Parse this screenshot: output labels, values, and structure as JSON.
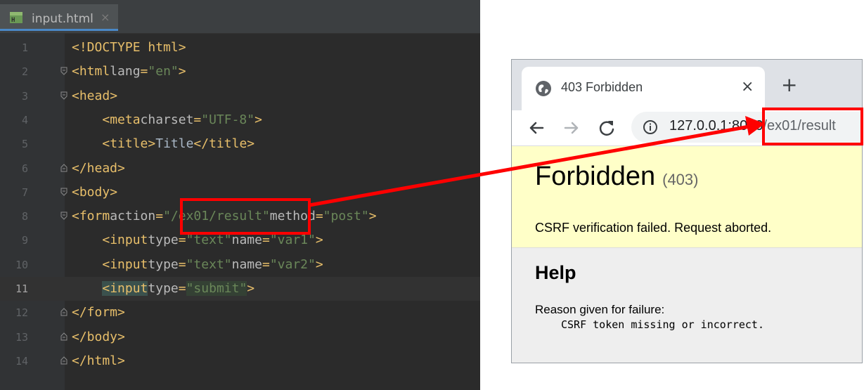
{
  "editor": {
    "tab": {
      "filename": "input.html",
      "close_glyph": "×",
      "icon": "html-file-icon"
    },
    "current_line": 11,
    "lines": [
      {
        "num": "1",
        "code": "<!DOCTYPE html>"
      },
      {
        "num": "2",
        "code": "<html lang=\"en\">"
      },
      {
        "num": "3",
        "code": "<head>"
      },
      {
        "num": "4",
        "code": "    <meta charset=\"UTF-8\">"
      },
      {
        "num": "5",
        "code": "    <title>Title</title>"
      },
      {
        "num": "6",
        "code": "</head>"
      },
      {
        "num": "7",
        "code": "<body>"
      },
      {
        "num": "8",
        "code": "<form action=\"/ex01/result\" method=\"post\">"
      },
      {
        "num": "9",
        "code": "    <input type=\"text\" name=\"var1\">"
      },
      {
        "num": "10",
        "code": "    <input type=\"text\" name=\"var2\">"
      },
      {
        "num": "11",
        "code": "    <input type=\"submit\">"
      },
      {
        "num": "12",
        "code": "</form>"
      },
      {
        "num": "13",
        "code": "</body>"
      },
      {
        "num": "14",
        "code": "</html>"
      }
    ]
  },
  "browser": {
    "tab_title": "403 Forbidden",
    "tab_close": "×",
    "new_tab": "+",
    "url_host": "127.0.0.1:8000",
    "url_path": "/ex01/result",
    "heading": "Forbidden",
    "status_code": "(403)",
    "message": "CSRF verification failed. Request aborted.",
    "help_heading": "Help",
    "reason_label": "Reason given for failure:",
    "reason_detail": "CSRF token missing or incorrect."
  },
  "colors": {
    "annotation": "#ff0000",
    "editor_bg": "#2b2b2b",
    "tag": "#e8bf6a",
    "string": "#6a8759",
    "summary_bg": "#ffffc8"
  }
}
